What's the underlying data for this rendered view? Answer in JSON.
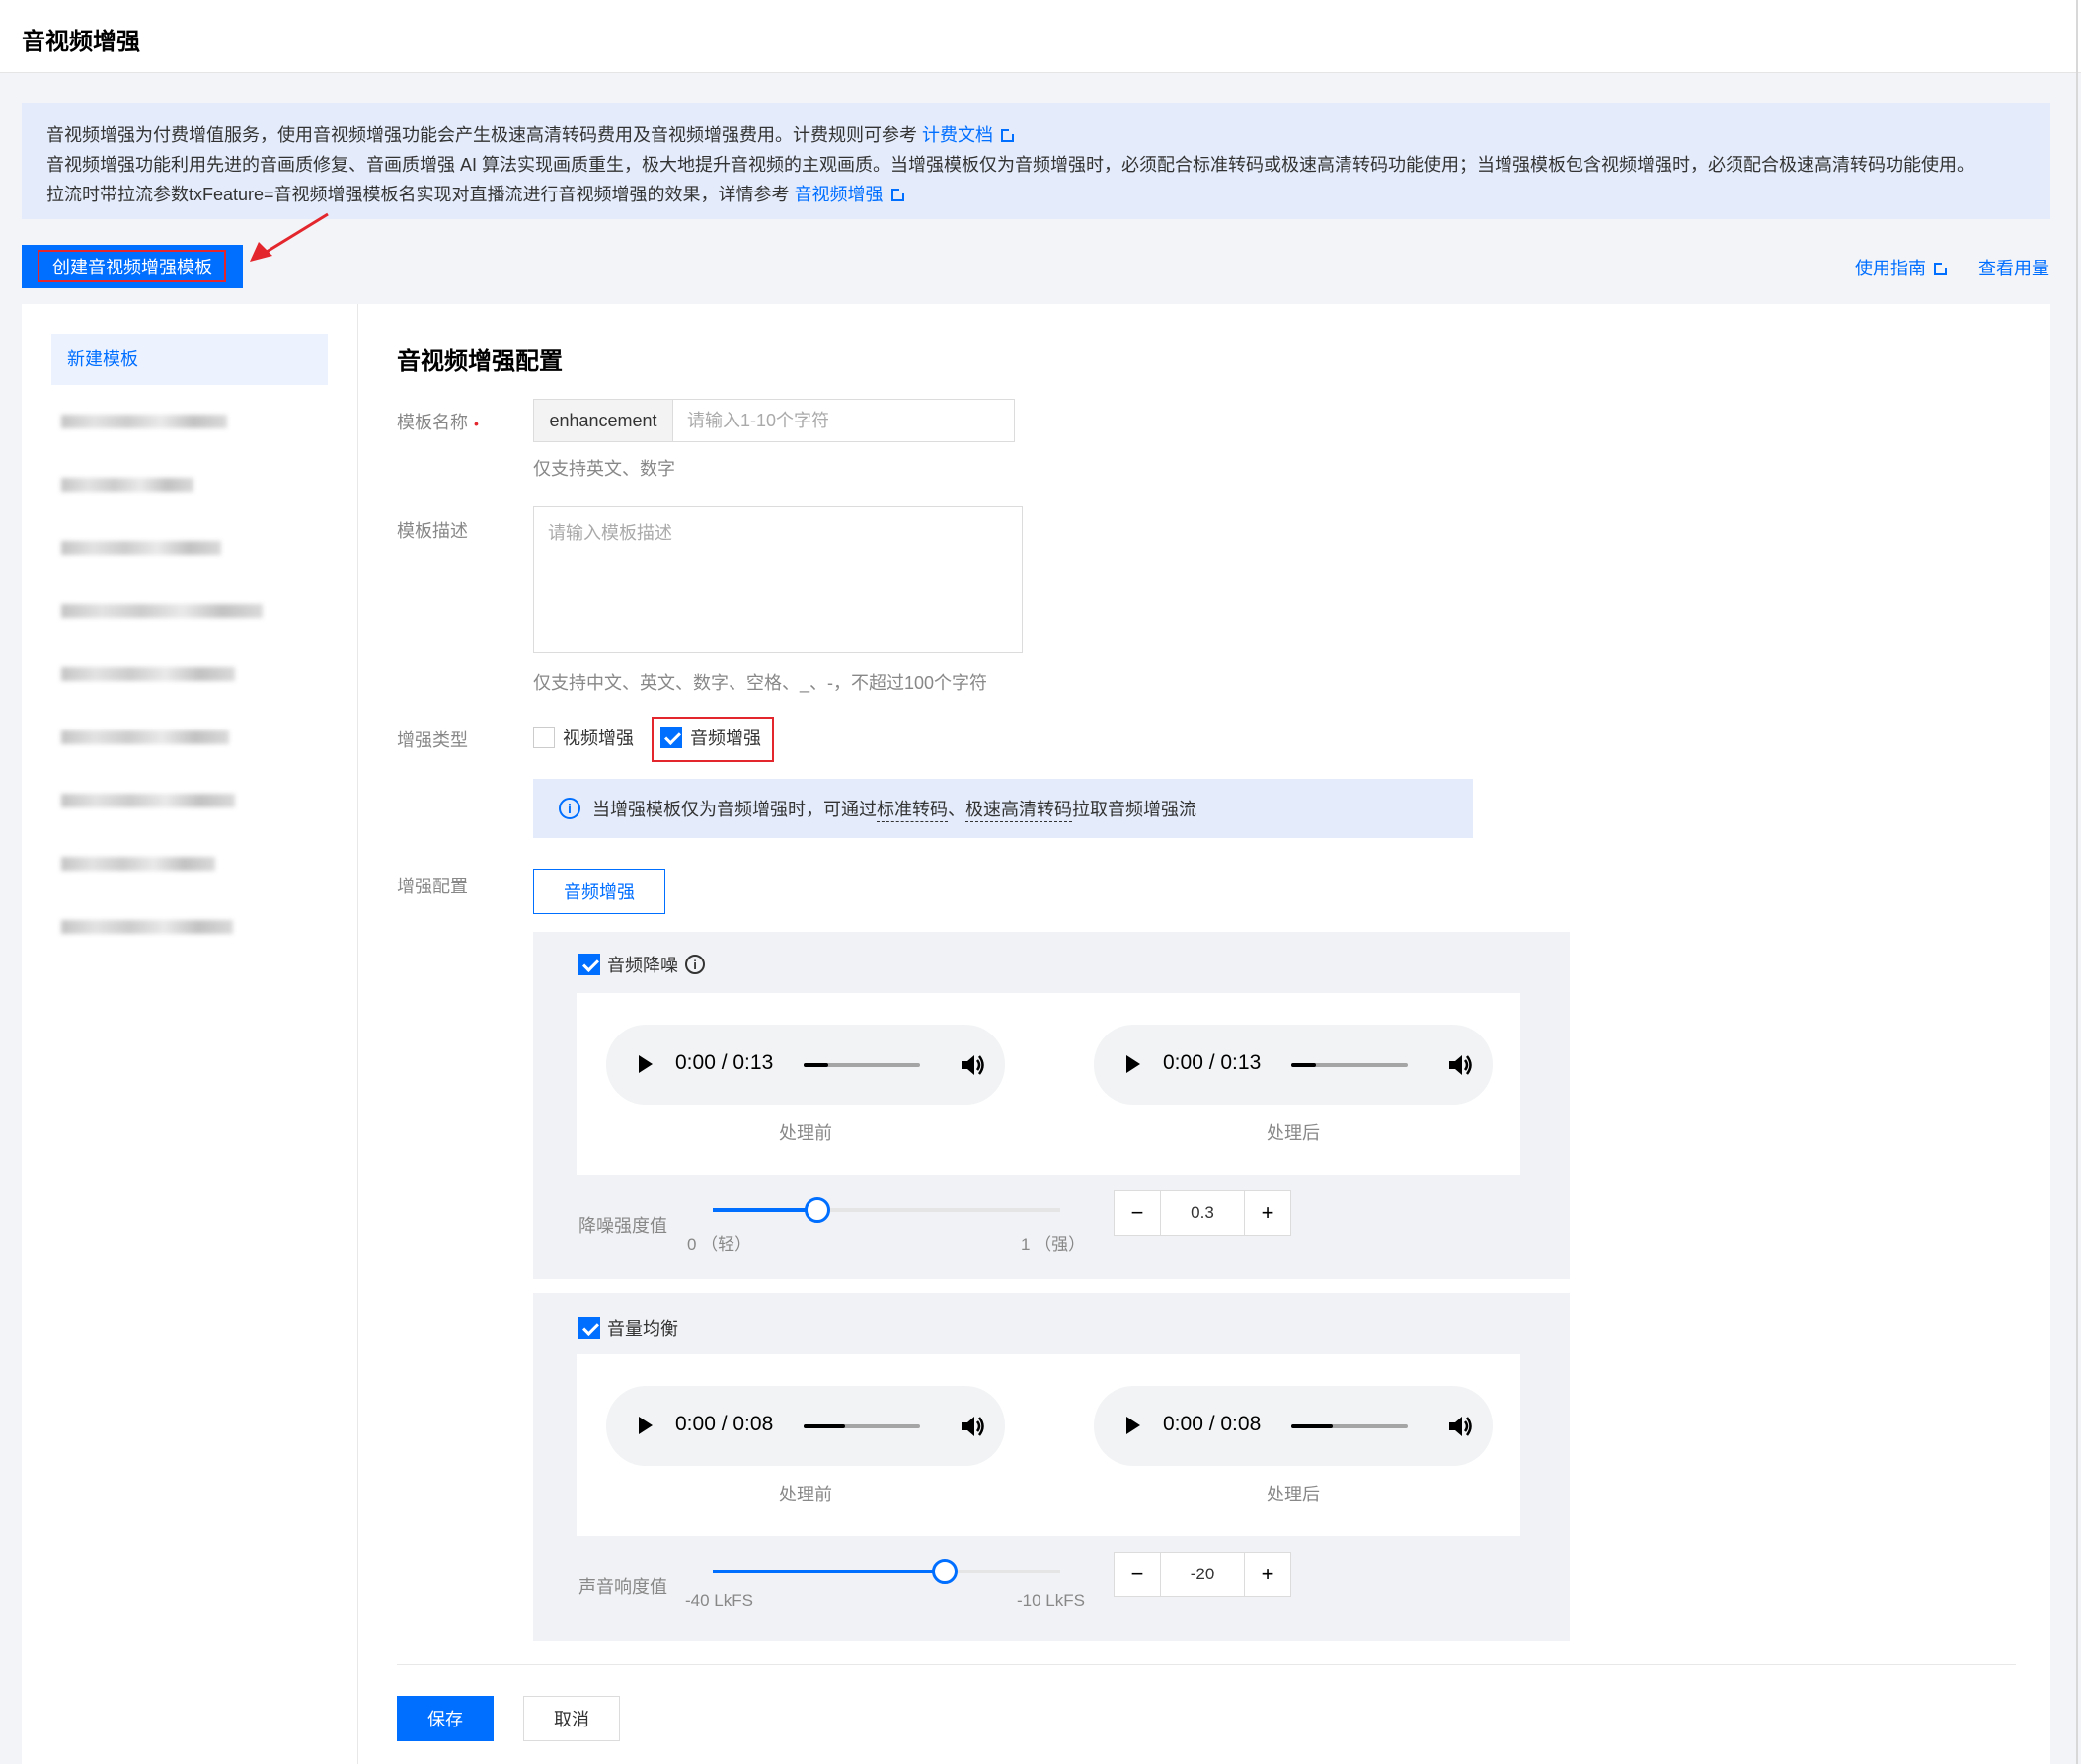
{
  "header": {
    "title": "音视频增强"
  },
  "notice": {
    "line1": "音视频增强为付费增值服务，使用音视频增强功能会产生极速高清转码费用及音视频增强费用。计费规则可参考",
    "line1_link": "计费文档",
    "line2": "音视频增强功能利用先进的音画质修复、音画质增强 AI 算法实现画质重生，极大地提升音视频的主观画质。当增强模板仅为音频增强时，必须配合标准转码或极速高清转码功能使用；当增强模板包含视频增强时，必须配合极速高清转码功能使用。",
    "line3": "拉流时带拉流参数txFeature=音视频增强模板名实现对直播流进行音视频增强的效果，详情参考",
    "line3_link": "音视频增强"
  },
  "toolbar": {
    "create_label": "创建音视频增强模板",
    "guide_label": "使用指南",
    "usage_label": "查看用量"
  },
  "sidebar": {
    "active_item": "新建模板"
  },
  "form": {
    "section_title": "音视频增强配置",
    "name_label": "模板名称",
    "name_prefix": "enhancement",
    "name_placeholder": "请输入1-10个字符",
    "name_help": "仅支持英文、数字",
    "desc_label": "模板描述",
    "desc_placeholder": "请输入模板描述",
    "desc_help": "仅支持中文、英文、数字、空格、_、-，不超过100个字符",
    "type_label": "增强类型",
    "type_video": "视频增强",
    "type_audio": "音频增强",
    "info_prefix": "当增强模板仅为音频增强时，可通过",
    "info_link1": "标准转码",
    "info_sep": "、",
    "info_link2": "极速高清转码",
    "info_suffix": "拉取音频增强流",
    "config_label": "增强配置",
    "config_tab": "音频增强"
  },
  "denoise": {
    "title": "音频降噪",
    "before_time": "0:00 / 0:13",
    "after_time": "0:00 / 0:13",
    "before_caption": "处理前",
    "after_caption": "处理后",
    "slider_label": "降噪强度值",
    "min_label": "0 （轻）",
    "max_label": "1 （强）",
    "value": "0.3",
    "level": 0.3
  },
  "loudness": {
    "title": "音量均衡",
    "before_time": "0:00 / 0:08",
    "after_time": "0:00 / 0:08",
    "before_caption": "处理前",
    "after_caption": "处理后",
    "slider_label": "声音响度值",
    "min_label": "-40 LkFS",
    "max_label": "-10 LkFS",
    "value": "-20",
    "level": 0.667
  },
  "footer": {
    "save_label": "保存",
    "cancel_label": "取消"
  },
  "colors": {
    "primary": "#006eff",
    "highlight": "#e3262d",
    "notice_bg": "#e4ecfb"
  }
}
